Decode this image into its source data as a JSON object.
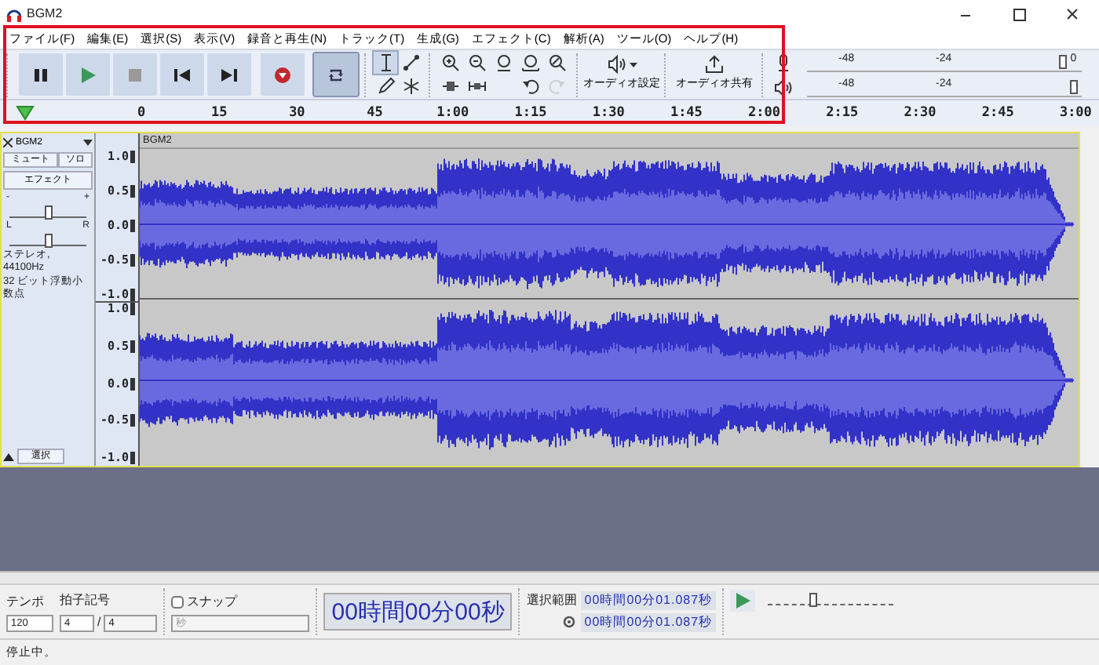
{
  "window": {
    "title": "BGM2"
  },
  "menu": [
    "ファイル(F)",
    "編集(E)",
    "選択(S)",
    "表示(V)",
    "録音と再生(N)",
    "トラック(T)",
    "生成(G)",
    "エフェクト(C)",
    "解析(A)",
    "ツール(O)",
    "ヘルプ(H)"
  ],
  "transport": [
    {
      "kind": "pause",
      "on": false
    },
    {
      "kind": "play",
      "on": false
    },
    {
      "kind": "stop",
      "on": false
    },
    {
      "kind": "skip-start",
      "on": false
    },
    {
      "kind": "skip-end",
      "on": false
    },
    {
      "kind": "record",
      "on": false
    },
    {
      "kind": "loop",
      "on": true
    }
  ],
  "tools": [
    {
      "kind": "ibeam",
      "selected": true
    },
    {
      "kind": "envelope",
      "selected": false
    },
    {
      "kind": "pencil",
      "selected": false
    },
    {
      "kind": "asterisk",
      "selected": false
    }
  ],
  "edit_buttons": [
    {
      "kind": "zoom-in",
      "disabled": false
    },
    {
      "kind": "zoom-out",
      "disabled": false
    },
    {
      "kind": "fit-selection",
      "disabled": false
    },
    {
      "kind": "fit-project",
      "disabled": false
    },
    {
      "kind": "zoom-toggle",
      "disabled": false
    },
    {
      "kind": "trim",
      "disabled": false
    },
    {
      "kind": "silence",
      "disabled": false
    },
    {
      "kind": "undo",
      "disabled": false
    },
    {
      "kind": "redo",
      "disabled": true
    }
  ],
  "audio_setup": "オーディオ設定",
  "share": "オーディオ共有",
  "meters": [
    {
      "kind": "record",
      "ticks": [
        "-48",
        "-24"
      ],
      "end": "0",
      "level": 0.93
    },
    {
      "kind": "playback",
      "ticks": [
        "-48",
        "-24"
      ],
      "level": 0.97
    }
  ],
  "ruler": [
    "0",
    "15",
    "30",
    "45",
    "1:00",
    "1:15",
    "1:30",
    "1:45",
    "2:00",
    "2:15",
    "2:30",
    "2:45",
    "3:00"
  ],
  "track": {
    "name": "BGM2",
    "mute": "ミュート",
    "solo": "ソロ",
    "effects": "エフェクト",
    "gain": {
      "min": "-",
      "max": "+",
      "level": 0.5
    },
    "pan": {
      "min": "L",
      "max": "R",
      "level": 0.5
    },
    "info": [
      "ステレオ, 44100Hz",
      "32 ビット浮動小数点"
    ],
    "select": "選択",
    "clip_name": "BGM2",
    "channels": [
      {
        "axis": [
          "1.0",
          "0.5",
          "0.0",
          "-0.5",
          "-1.0"
        ]
      },
      {
        "axis": [
          "1.0",
          "0.5",
          "0.0",
          "-0.5",
          "-1.0"
        ]
      }
    ]
  },
  "bottom": {
    "tempo_label": "テンポ",
    "tempo": "120",
    "timesig_label": "拍子記号",
    "beats": "4",
    "slash": "/",
    "unit": "4",
    "snap": {
      "label": "スナップ",
      "checked": false,
      "value": "秒"
    },
    "time": "00時間00分00秒",
    "selection_label": "選択範囲",
    "selection": [
      "00時間00分01.087秒",
      "00時間00分01.087秒"
    ],
    "speed": {
      "level": 0.37
    }
  },
  "status_bar": "停止中。"
}
